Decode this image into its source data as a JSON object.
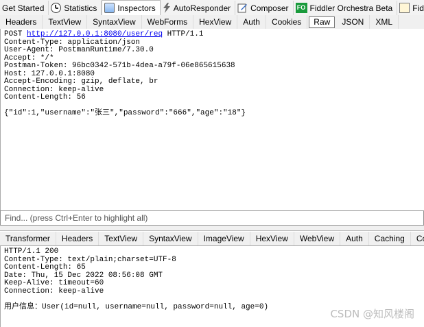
{
  "main_tabs": [
    {
      "label": "Get Started",
      "icon": "",
      "active": false
    },
    {
      "label": "Statistics",
      "icon": "clock-icon",
      "active": false
    },
    {
      "label": "Inspectors",
      "icon": "inspector-icon",
      "active": true
    },
    {
      "label": "AutoResponder",
      "icon": "lightning-icon",
      "active": false
    },
    {
      "label": "Composer",
      "icon": "composer-icon",
      "active": false
    },
    {
      "label": "Fiddler Orchestra Beta",
      "icon": "fo-icon",
      "icon_text": "FO",
      "active": false
    },
    {
      "label": "FiddlerScript",
      "icon": "js-icon",
      "active": false
    }
  ],
  "request_tabs": [
    "Headers",
    "TextView",
    "SyntaxView",
    "WebForms",
    "HexView",
    "Auth",
    "Cookies",
    "Raw",
    "JSON",
    "XML"
  ],
  "request_active_tab": "Raw",
  "request": {
    "request_line_method": "POST ",
    "request_line_url": "http://127.0.0.1:8080/user/req",
    "request_line_version": " HTTP/1.1",
    "headers": [
      "Content-Type: application/json",
      "User-Agent: PostmanRuntime/7.30.0",
      "Accept: */*",
      "Postman-Token: 96bc0342-571b-4dea-a79f-06e865615638",
      "Host: 127.0.0.1:8080",
      "Accept-Encoding: gzip, deflate, br",
      "Connection: keep-alive",
      "Content-Length: 56"
    ],
    "body": "{\"id\":1,\"username\":\"张三\",\"password\":\"666\",\"age\":\"18\"}"
  },
  "find": {
    "placeholder": "Find... (press Ctrl+Enter to highlight all)"
  },
  "response_tabs": [
    "Transformer",
    "Headers",
    "TextView",
    "SyntaxView",
    "ImageView",
    "HexView",
    "WebView",
    "Auth",
    "Caching",
    "Cookies"
  ],
  "response": {
    "lines": [
      "HTTP/1.1 200",
      "Content-Type: text/plain;charset=UTF-8",
      "Content-Length: 65",
      "Date: Thu, 15 Dec 2022 08:56:08 GMT",
      "Keep-Alive: timeout=60",
      "Connection: keep-alive"
    ],
    "body": "用户信息：User(id=null, username=null, password=null, age=0)"
  },
  "watermark": "CSDN @知风楼阁"
}
